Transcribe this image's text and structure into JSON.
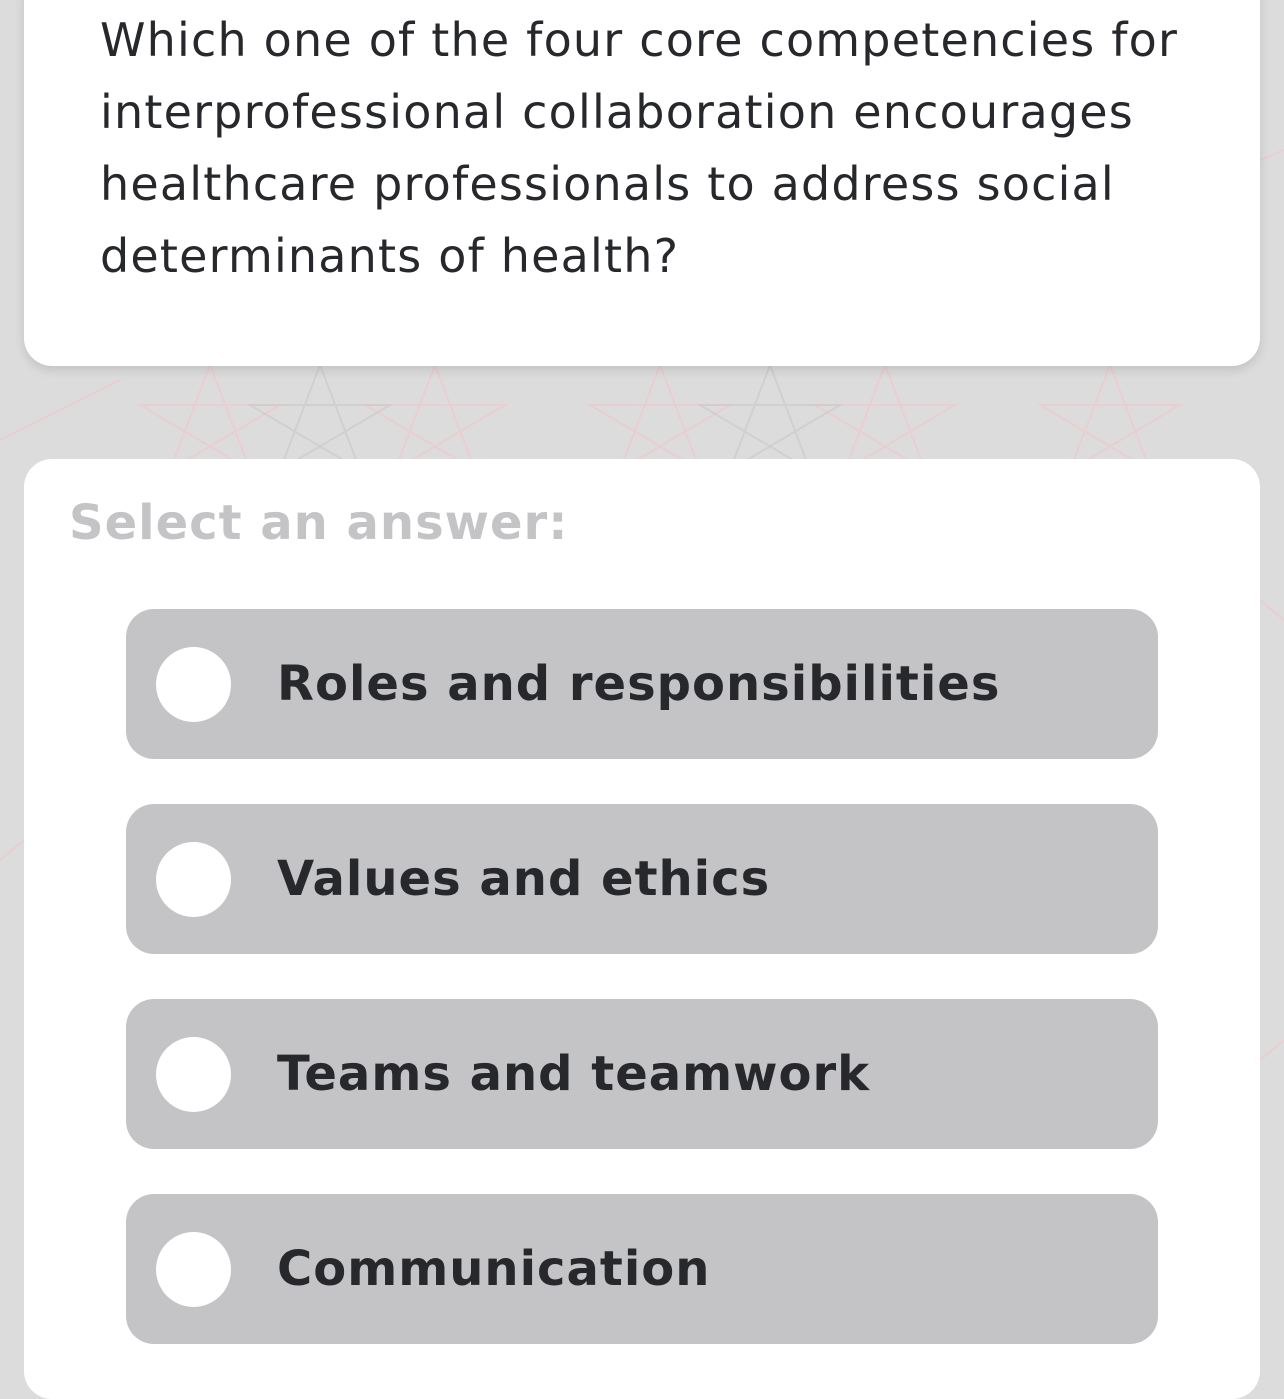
{
  "question": {
    "text": "Which one of the four core competencies for interprofessional collaboration encourages healthcare professionals to address social determinants of health?"
  },
  "answers": {
    "prompt": "Select an answer:",
    "options": [
      {
        "label": "Roles and responsibilities"
      },
      {
        "label": "Values and ethics"
      },
      {
        "label": "Teams and teamwork"
      },
      {
        "label": "Communication"
      }
    ]
  },
  "colors": {
    "background": "#dcdcdc",
    "card": "#ffffff",
    "option_fill": "#c4c4c6",
    "text": "#26282b",
    "prompt_text": "#c4c4c6"
  }
}
